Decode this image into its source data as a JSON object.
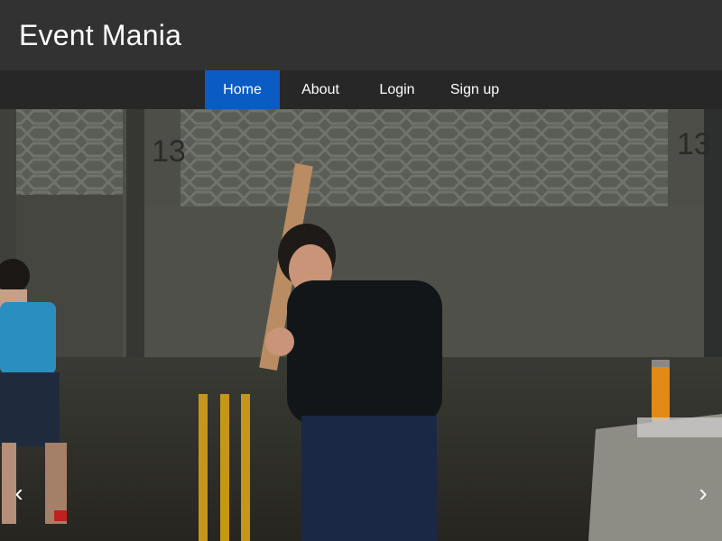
{
  "app": {
    "title": "Event Mania"
  },
  "nav": {
    "items": [
      {
        "label": "Home",
        "active": true
      },
      {
        "label": "About",
        "active": false
      },
      {
        "label": "Login",
        "active": false
      },
      {
        "label": "Sign up",
        "active": false
      }
    ]
  },
  "carousel": {
    "prev_glyph": "‹",
    "next_glyph": "›",
    "prev_icon": "chevron-left-icon",
    "next_icon": "chevron-right-icon"
  },
  "colors": {
    "header_bg": "#323232",
    "navbar_bg": "#272727",
    "active_nav": "#0a5bc4"
  }
}
